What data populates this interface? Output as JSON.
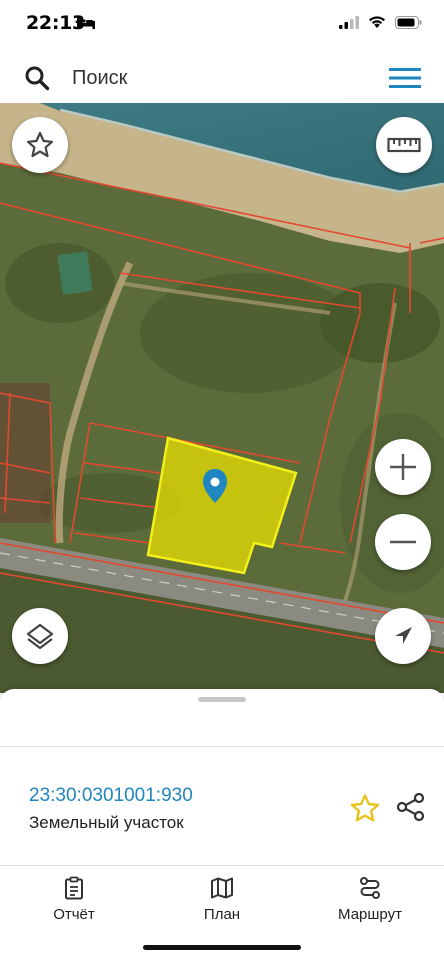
{
  "status_bar": {
    "time": "22:13"
  },
  "search": {
    "placeholder": "Поиск"
  },
  "map": {
    "selected_parcel_marker": "location-pin-icon"
  },
  "map_controls": {
    "favorite": "star-icon",
    "ruler": "ruler-icon",
    "zoom_in": "plus-icon",
    "zoom_out": "minus-icon",
    "layers": "layers-icon",
    "locate": "navigation-arrow-icon"
  },
  "parcel": {
    "cadastral_number": "23:30:0301001:930",
    "type": "Земельный участок"
  },
  "tabs": [
    {
      "label": "Отчёт",
      "icon": "report-icon"
    },
    {
      "label": "План",
      "icon": "map-icon"
    },
    {
      "label": "Маршрут",
      "icon": "route-icon"
    }
  ],
  "colors": {
    "accent": "#1f86bf",
    "parcel_fill": "#e8e000",
    "boundary": "#e2492f",
    "star": "#e8c21e"
  }
}
